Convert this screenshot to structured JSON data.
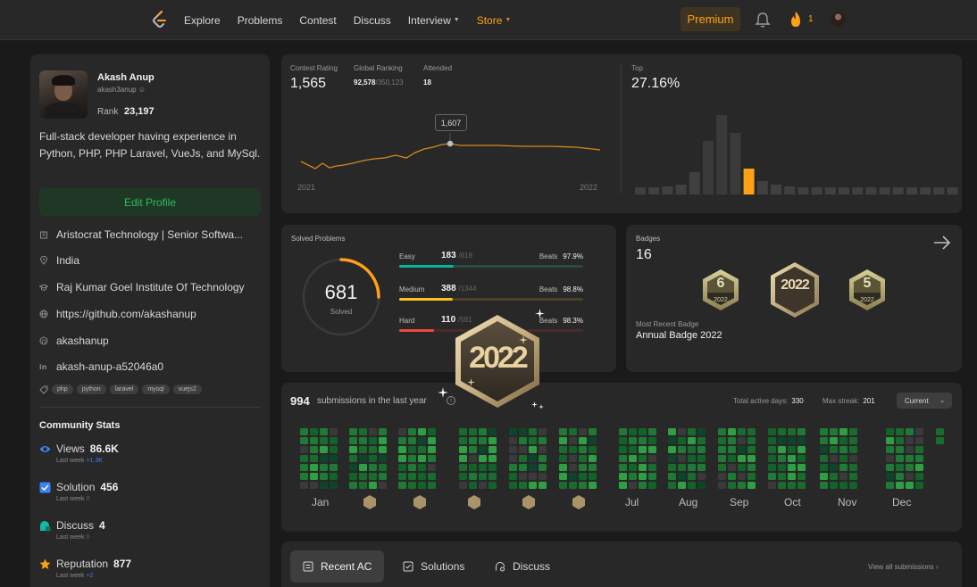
{
  "nav": {
    "links": [
      "Explore",
      "Problems",
      "Contest",
      "Discuss",
      "Interview",
      "Store"
    ],
    "premium": "Premium",
    "fire_count": "1"
  },
  "profile": {
    "name": "Akash Anup",
    "handle": "akash3anup",
    "rank_label": "Rank",
    "rank": "23,197",
    "bio": "Full-stack developer having experience in Python, PHP, PHP Laravel, VueJs, and MySql.",
    "edit_label": "Edit Profile",
    "company": "Aristocrat Technology | Senior Softwa...",
    "location": "India",
    "school": "Raj Kumar Goel Institute Of Technology",
    "website": "https://github.com/akashanup",
    "github": "akashanup",
    "linkedin": "akash-anup-a52046a0",
    "tags": [
      "php",
      "python",
      "laravel",
      "mysql",
      "vuejs2"
    ]
  },
  "community": {
    "title": "Community Stats",
    "stats": [
      {
        "label": "Views",
        "value": "86.6K",
        "sub": "Last week",
        "delta": "+1.3K",
        "icon": "eye-icon",
        "color": "#3b82f6"
      },
      {
        "label": "Solution",
        "value": "456",
        "sub": "Last week",
        "delta": "0",
        "icon": "check-square-icon",
        "color": "#3b82f6"
      },
      {
        "label": "Discuss",
        "value": "4",
        "sub": "Last week",
        "delta": "0",
        "icon": "chat-icon",
        "color": "#14b8a6"
      },
      {
        "label": "Reputation",
        "value": "877",
        "sub": "Last week",
        "delta": "+2",
        "icon": "star-icon",
        "color": "#ffa116"
      }
    ]
  },
  "contest": {
    "rating_label": "Contest Rating",
    "rating": "1,565",
    "global_label": "Global Ranking",
    "global_rank": "92,578",
    "global_total": "/350,123",
    "attended_label": "Attended",
    "attended": "18",
    "year_start": "2021",
    "year_end": "2022",
    "tooltip_value": "1,607",
    "top_label": "Top",
    "top_value": "27.16%"
  },
  "solved": {
    "title": "Solved Problems",
    "total": "681",
    "total_label": "Solved",
    "difficulties": [
      {
        "name": "Easy",
        "solved": "183",
        "total": "/618",
        "beats_label": "Beats",
        "beats": "97.9%",
        "fraction": 0.296,
        "color": "#00b8a3",
        "track": "#2a4a45"
      },
      {
        "name": "Medium",
        "solved": "388",
        "total": "/1344",
        "beats_label": "Beats",
        "beats": "98.8%",
        "fraction": 0.289,
        "color": "#ffc01e",
        "track": "#4a4128"
      },
      {
        "name": "Hard",
        "solved": "110",
        "total": "/581",
        "beats_label": "Beats",
        "beats": "98.3%",
        "fraction": 0.189,
        "color": "#ef4743",
        "track": "#4a2a2a"
      }
    ]
  },
  "badges": {
    "title": "Badges",
    "count": "16",
    "recent_label": "Most Recent Badge",
    "recent_name": "Annual Badge 2022",
    "items": [
      {
        "digit": "6",
        "year": "2022"
      },
      {
        "digit": "2022",
        "year": ""
      },
      {
        "digit": "5",
        "year": "2022"
      }
    ],
    "big_badge_text": "2022"
  },
  "submissions": {
    "count": "994",
    "text": "submissions in the last year",
    "active_label": "Total active days:",
    "active_days": "330",
    "streak_label": "Max streak:",
    "max_streak": "201",
    "selector": "Current",
    "months": [
      "Jan",
      "Jul",
      "Aug",
      "Sep",
      "Oct",
      "Nov",
      "Dec"
    ]
  },
  "tabs": {
    "items": [
      "Recent AC",
      "Solutions",
      "Discuss"
    ],
    "view_all": "View all submissions"
  },
  "colors": {
    "accent": "#ffa116",
    "green": "#2cbb5d",
    "panel": "#282828",
    "background": "#1a1a1a"
  }
}
